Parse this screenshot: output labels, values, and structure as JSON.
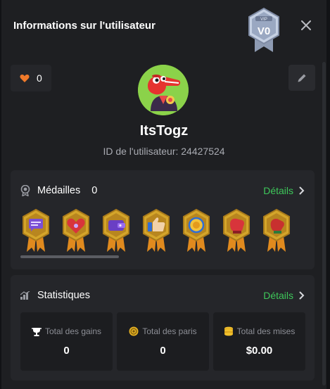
{
  "modal": {
    "title": "Informations sur l'utilisateur",
    "vip_badge": {
      "top_text": "VIP",
      "level": "V0"
    }
  },
  "profile": {
    "likes": "0",
    "username": "ItsTogz",
    "user_id_label": "ID de l'utilisateur: 24427524"
  },
  "medals": {
    "title": "Médailles",
    "count": "0",
    "details_label": "Détails",
    "items": [
      "chat-medal",
      "heart-medal",
      "wallet-medal",
      "thumbs-up-medal",
      "coin-medal",
      "fist-medal",
      "fist-medal"
    ]
  },
  "stats": {
    "title": "Statistiques",
    "details_label": "Détails",
    "items": [
      {
        "label": "Total des gains",
        "value": "0",
        "icon": "trophy-icon"
      },
      {
        "label": "Total des paris",
        "value": "0",
        "icon": "chip-icon"
      },
      {
        "label": "Total des mises",
        "value": "$0.00",
        "icon": "coins-icon"
      }
    ]
  },
  "colors": {
    "accent_green": "#3ec75a",
    "heart": "#f07a2a",
    "medal_gold": "#d4a52a"
  }
}
